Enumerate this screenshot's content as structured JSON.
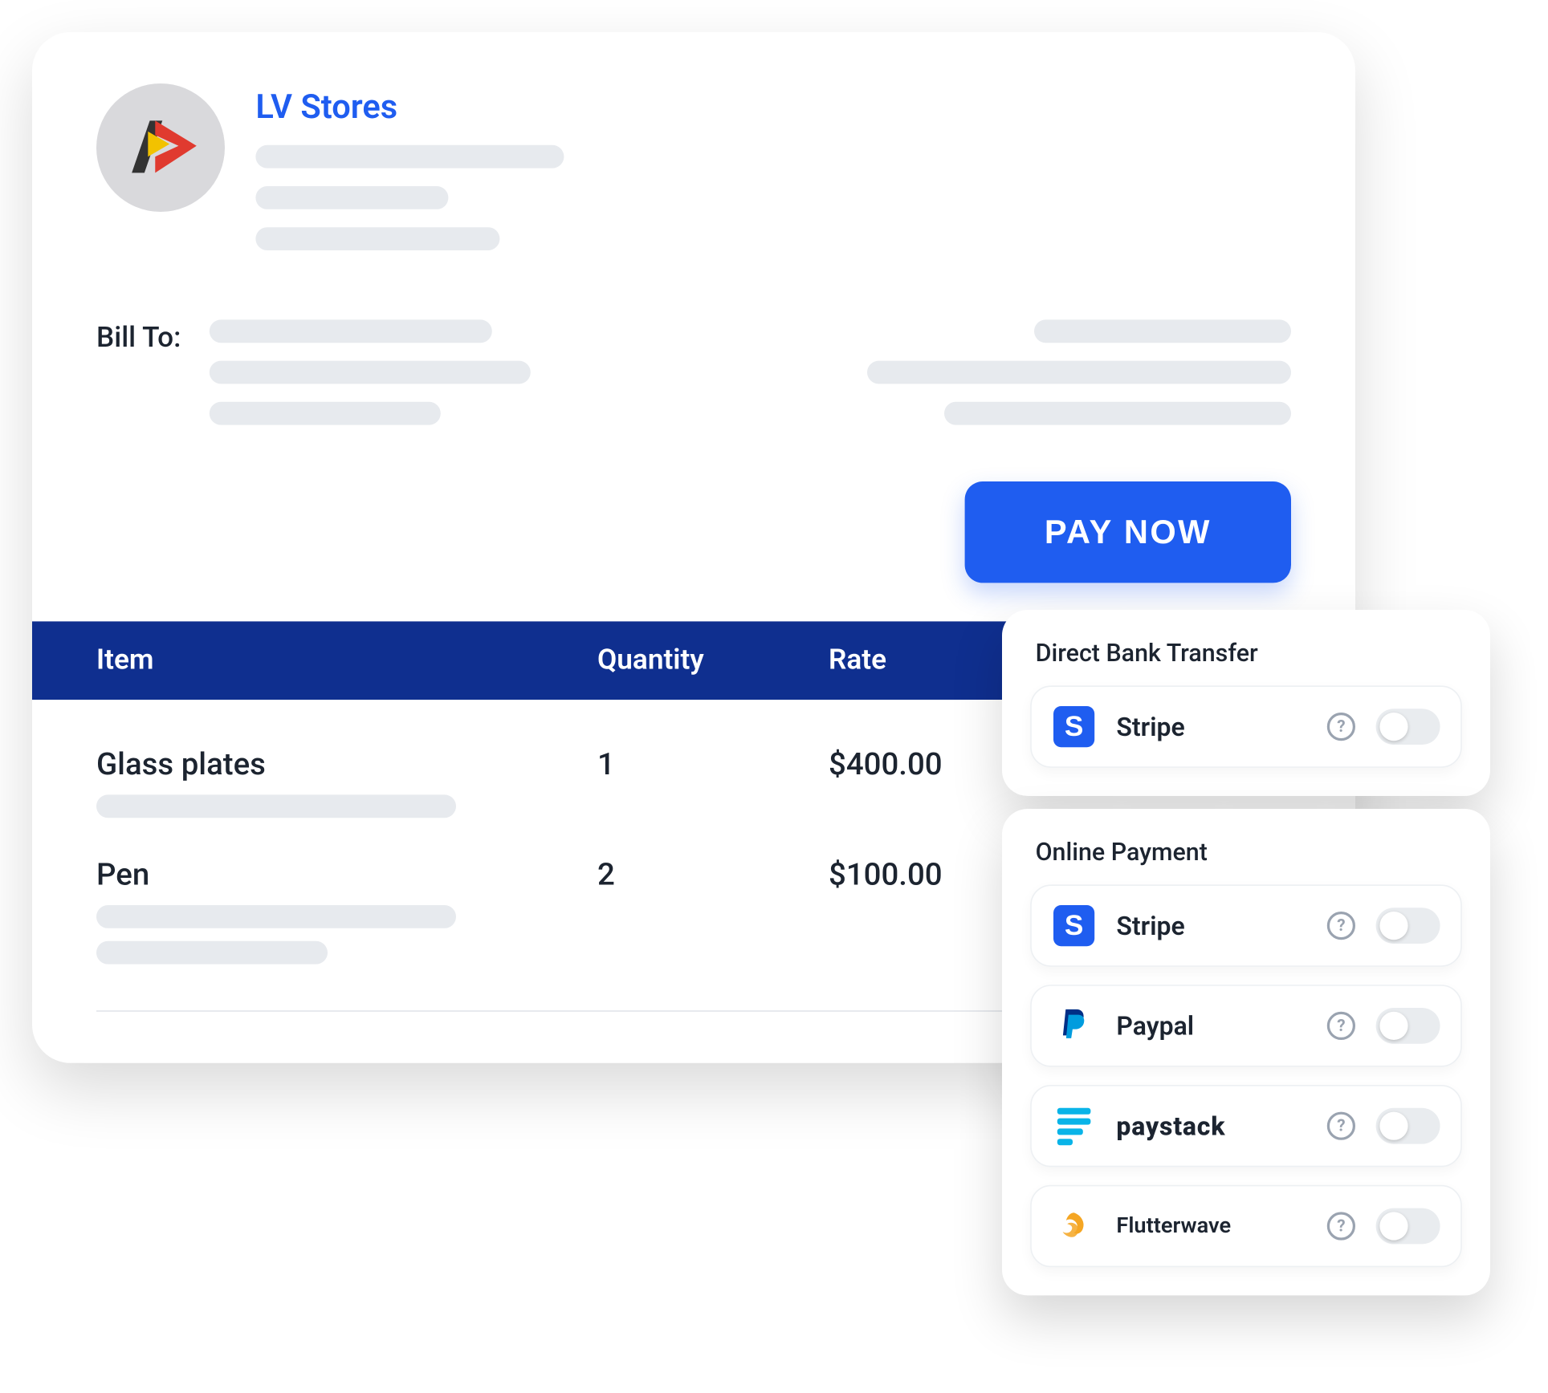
{
  "store": {
    "name": "LV Stores"
  },
  "billto": {
    "label": "Bill To:"
  },
  "actions": {
    "pay_now": "PAY NOW"
  },
  "table": {
    "headers": {
      "item": "Item",
      "quantity": "Quantity",
      "rate": "Rate"
    },
    "rows": [
      {
        "name": "Glass plates",
        "quantity": "1",
        "rate": "$400.00"
      },
      {
        "name": "Pen",
        "quantity": "2",
        "rate": "$100.00"
      }
    ]
  },
  "panels": {
    "direct_bank": {
      "title": "Direct Bank Transfer",
      "providers": [
        {
          "name": "Stripe",
          "icon": "stripe",
          "enabled": false
        }
      ]
    },
    "online_payment": {
      "title": "Online Payment",
      "providers": [
        {
          "name": "Stripe",
          "icon": "stripe",
          "enabled": false
        },
        {
          "name": "Paypal",
          "icon": "paypal",
          "enabled": false
        },
        {
          "name": "paystack",
          "icon": "paystack",
          "enabled": false
        },
        {
          "name": "Flutterwave",
          "icon": "flutterwave",
          "enabled": false
        }
      ]
    }
  }
}
